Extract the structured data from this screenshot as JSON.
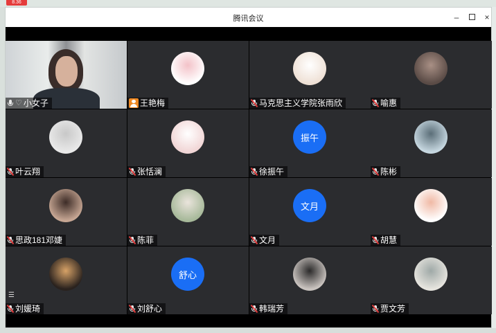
{
  "desktop": {
    "badge": "8.36"
  },
  "window": {
    "title": "腾讯会议",
    "controls": {
      "minimize": "–",
      "close": "×"
    }
  },
  "participants": [
    {
      "name": "小女子",
      "kind": "video",
      "mic": "on",
      "extra": "♡"
    },
    {
      "name": "王艳梅",
      "kind": "image",
      "mic": "user-icon",
      "avatar_colors": [
        "#ffffff",
        "#f3c2c8"
      ]
    },
    {
      "name": "马克思主义学院张雨欣",
      "kind": "image",
      "mic": "muted",
      "avatar_colors": [
        "#efe1d6",
        "#ffffff"
      ]
    },
    {
      "name": "喻惠",
      "kind": "image",
      "mic": "muted",
      "avatar_colors": [
        "#5a4b46",
        "#a99085"
      ]
    },
    {
      "name": "叶云翔",
      "kind": "image",
      "mic": "muted",
      "avatar_colors": [
        "#e9e9e9",
        "#c8c8c8"
      ]
    },
    {
      "name": "张恬澜",
      "kind": "image",
      "mic": "muted",
      "avatar_colors": [
        "#f1d6d6",
        "#ffffff"
      ]
    },
    {
      "name": "徐振午",
      "kind": "text",
      "mic": "muted",
      "avatar_text": "振午",
      "avatar_colors": [
        "#1a6ef5",
        "#1a6ef5"
      ]
    },
    {
      "name": "陈彬",
      "kind": "image",
      "mic": "muted",
      "avatar_colors": [
        "#c6d7e0",
        "#5b6e78"
      ]
    },
    {
      "name": "思政181邓婕",
      "kind": "image",
      "mic": "muted",
      "avatar_colors": [
        "#c6a693",
        "#3d2c27"
      ]
    },
    {
      "name": "陈菲",
      "kind": "image",
      "mic": "muted",
      "avatar_colors": [
        "#a7b99a",
        "#eae4dc"
      ]
    },
    {
      "name": "文月",
      "kind": "text",
      "mic": "muted",
      "avatar_text": "文月",
      "avatar_colors": [
        "#1a6ef5",
        "#1a6ef5"
      ]
    },
    {
      "name": "胡慧",
      "kind": "image",
      "mic": "muted",
      "avatar_colors": [
        "#ffffff",
        "#f0b9a5"
      ]
    },
    {
      "name": "刘媛琦",
      "kind": "image",
      "mic": "muted",
      "avatar_colors": [
        "#2a221e",
        "#d7a267"
      ]
    },
    {
      "name": "刘舒心",
      "kind": "text",
      "mic": "muted",
      "avatar_text": "舒心",
      "avatar_colors": [
        "#1a6ef5",
        "#1a6ef5"
      ]
    },
    {
      "name": "韩瑞芳",
      "kind": "image",
      "mic": "muted",
      "avatar_colors": [
        "#c9c3bf",
        "#2b2a2a"
      ]
    },
    {
      "name": "贾文芳",
      "kind": "image",
      "mic": "muted",
      "avatar_colors": [
        "#e6e4de",
        "#9fa9a7"
      ]
    }
  ],
  "colors": {
    "tile_bg": "#2b2c2f",
    "stage_bg": "#000000",
    "accent_blue": "#1a6ef5",
    "active_border": "#35c46a",
    "muted_red": "#e23d3d"
  }
}
